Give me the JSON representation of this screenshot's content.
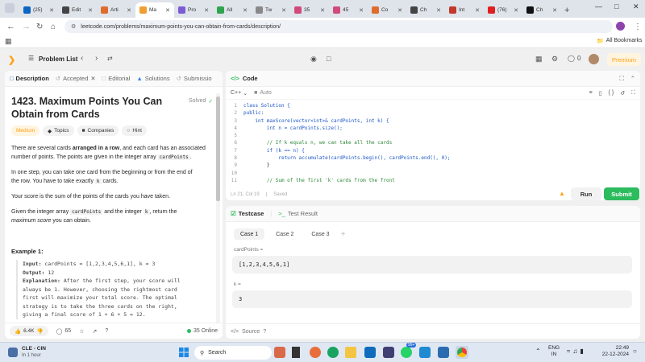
{
  "browser": {
    "tabs": [
      {
        "label": "(25)",
        "color": "#0a66c2"
      },
      {
        "label": "Edit",
        "color": "#444444"
      },
      {
        "label": "Arti",
        "color": "#e06c2c"
      },
      {
        "label": "Ma",
        "color": "#f0a030",
        "active": true
      },
      {
        "label": "Pro",
        "color": "#7b5cd6"
      },
      {
        "label": "All",
        "color": "#2ea44f"
      },
      {
        "label": "Tw",
        "color": "#888888"
      },
      {
        "label": "35",
        "color": "#d04a7a"
      },
      {
        "label": "45",
        "color": "#d04a7a"
      },
      {
        "label": "Co",
        "color": "#e06c2c"
      },
      {
        "label": "Ch",
        "color": "#444444"
      },
      {
        "label": "Int",
        "color": "#c0392b"
      },
      {
        "label": "(76)",
        "color": "#e02020"
      },
      {
        "label": "Ch",
        "color": "#111111"
      }
    ],
    "url": "leetcode.com/problems/maximum-points-you-can-obtain-from-cards/description/",
    "bookmarks_label": "All Bookmarks"
  },
  "nav": {
    "problem_list": "Problem List",
    "streak": "0",
    "premium": "Premium"
  },
  "left": {
    "tabs": {
      "description": "Description",
      "accepted": "Accepted",
      "editorial": "Editorial",
      "solutions": "Solutions",
      "submissions": "Submissio"
    },
    "title_line1": "1423. Maximum Points You Can",
    "title_line2": "Obtain from Cards",
    "solved": "Solved",
    "difficulty": "Medium",
    "topics": "Topics",
    "companies": "Companies",
    "hint": "Hint",
    "p1a": "There are several cards ",
    "p1b": "arranged in a row",
    "p1c": ", and each card has an associated",
    "p1d": "number of points. The points are given in the integer array ",
    "p1e": "cardPoints",
    "p1f": ".",
    "p2a": "In one step, you can take one card from the beginning or from the end of",
    "p2b": "the row. You have to take exactly ",
    "p2c": "k",
    "p2d": " cards.",
    "p3": "Your score is the sum of the points of the cards you have taken.",
    "p4a": "Given the integer array ",
    "p4b": "cardPoints",
    "p4c": " and the integer ",
    "p4d": "k",
    "p4e": ", return the",
    "p4f": "maximum score",
    "p4g": " you can obtain.",
    "example_title": "Example 1:",
    "ex_input_label": "Input:",
    "ex_input": " cardPoints = [1,2,3,4,5,6,1], k = 3",
    "ex_output_label": "Output:",
    "ex_output": " 12",
    "ex_expl_label": "Explanation:",
    "ex_expl1": " After the first step, your score will",
    "ex_expl2": "always be 1. However, choosing the rightmost card",
    "ex_expl3": "first will maximize your total score. The optimal",
    "ex_expl4": "strategy is to take the three cards on the right,",
    "ex_expl5": "giving a final score of 1 + 6 + 5 = 12.",
    "likes": "6.4K",
    "comments": "65",
    "online": "35 Online"
  },
  "code": {
    "title": "Code",
    "lang": "C++",
    "auto": "Auto",
    "lines": [
      "class Solution {",
      "public:",
      "    int maxScore(vector<int>& cardPoints, int k) {",
      "        int n = cardPoints.size();",
      "",
      "        // If k equals n, we can take all the cards",
      "        if (k == n) {",
      "            return accumulate(cardPoints.begin(), cardPoints.end(), 0);",
      "        }",
      "",
      "        // Sum of the first 'k' cards from the front"
    ],
    "status": "Ln 21, Col 19",
    "saved": "Saved",
    "run": "Run",
    "submit": "Submit"
  },
  "testcase": {
    "tab": "Testcase",
    "result_tab": "Test Result",
    "cases": [
      "Case 1",
      "Case 2",
      "Case 3"
    ],
    "var1_label": "cardPoints =",
    "var1_value": "[1,2,3,4,5,6,1]",
    "var2_label": "k =",
    "var2_value": "3",
    "source": "Source"
  },
  "taskbar": {
    "weather_title": "CLE - CIN",
    "weather_sub": "In 1 hour",
    "search": "Search",
    "lang1": "ENG",
    "lang2": "IN",
    "time": "22:49",
    "date": "22-12-2024"
  },
  "colors": {
    "accent": "#ffa116",
    "submit": "#2cbb5d",
    "link": "#0a66c2"
  }
}
